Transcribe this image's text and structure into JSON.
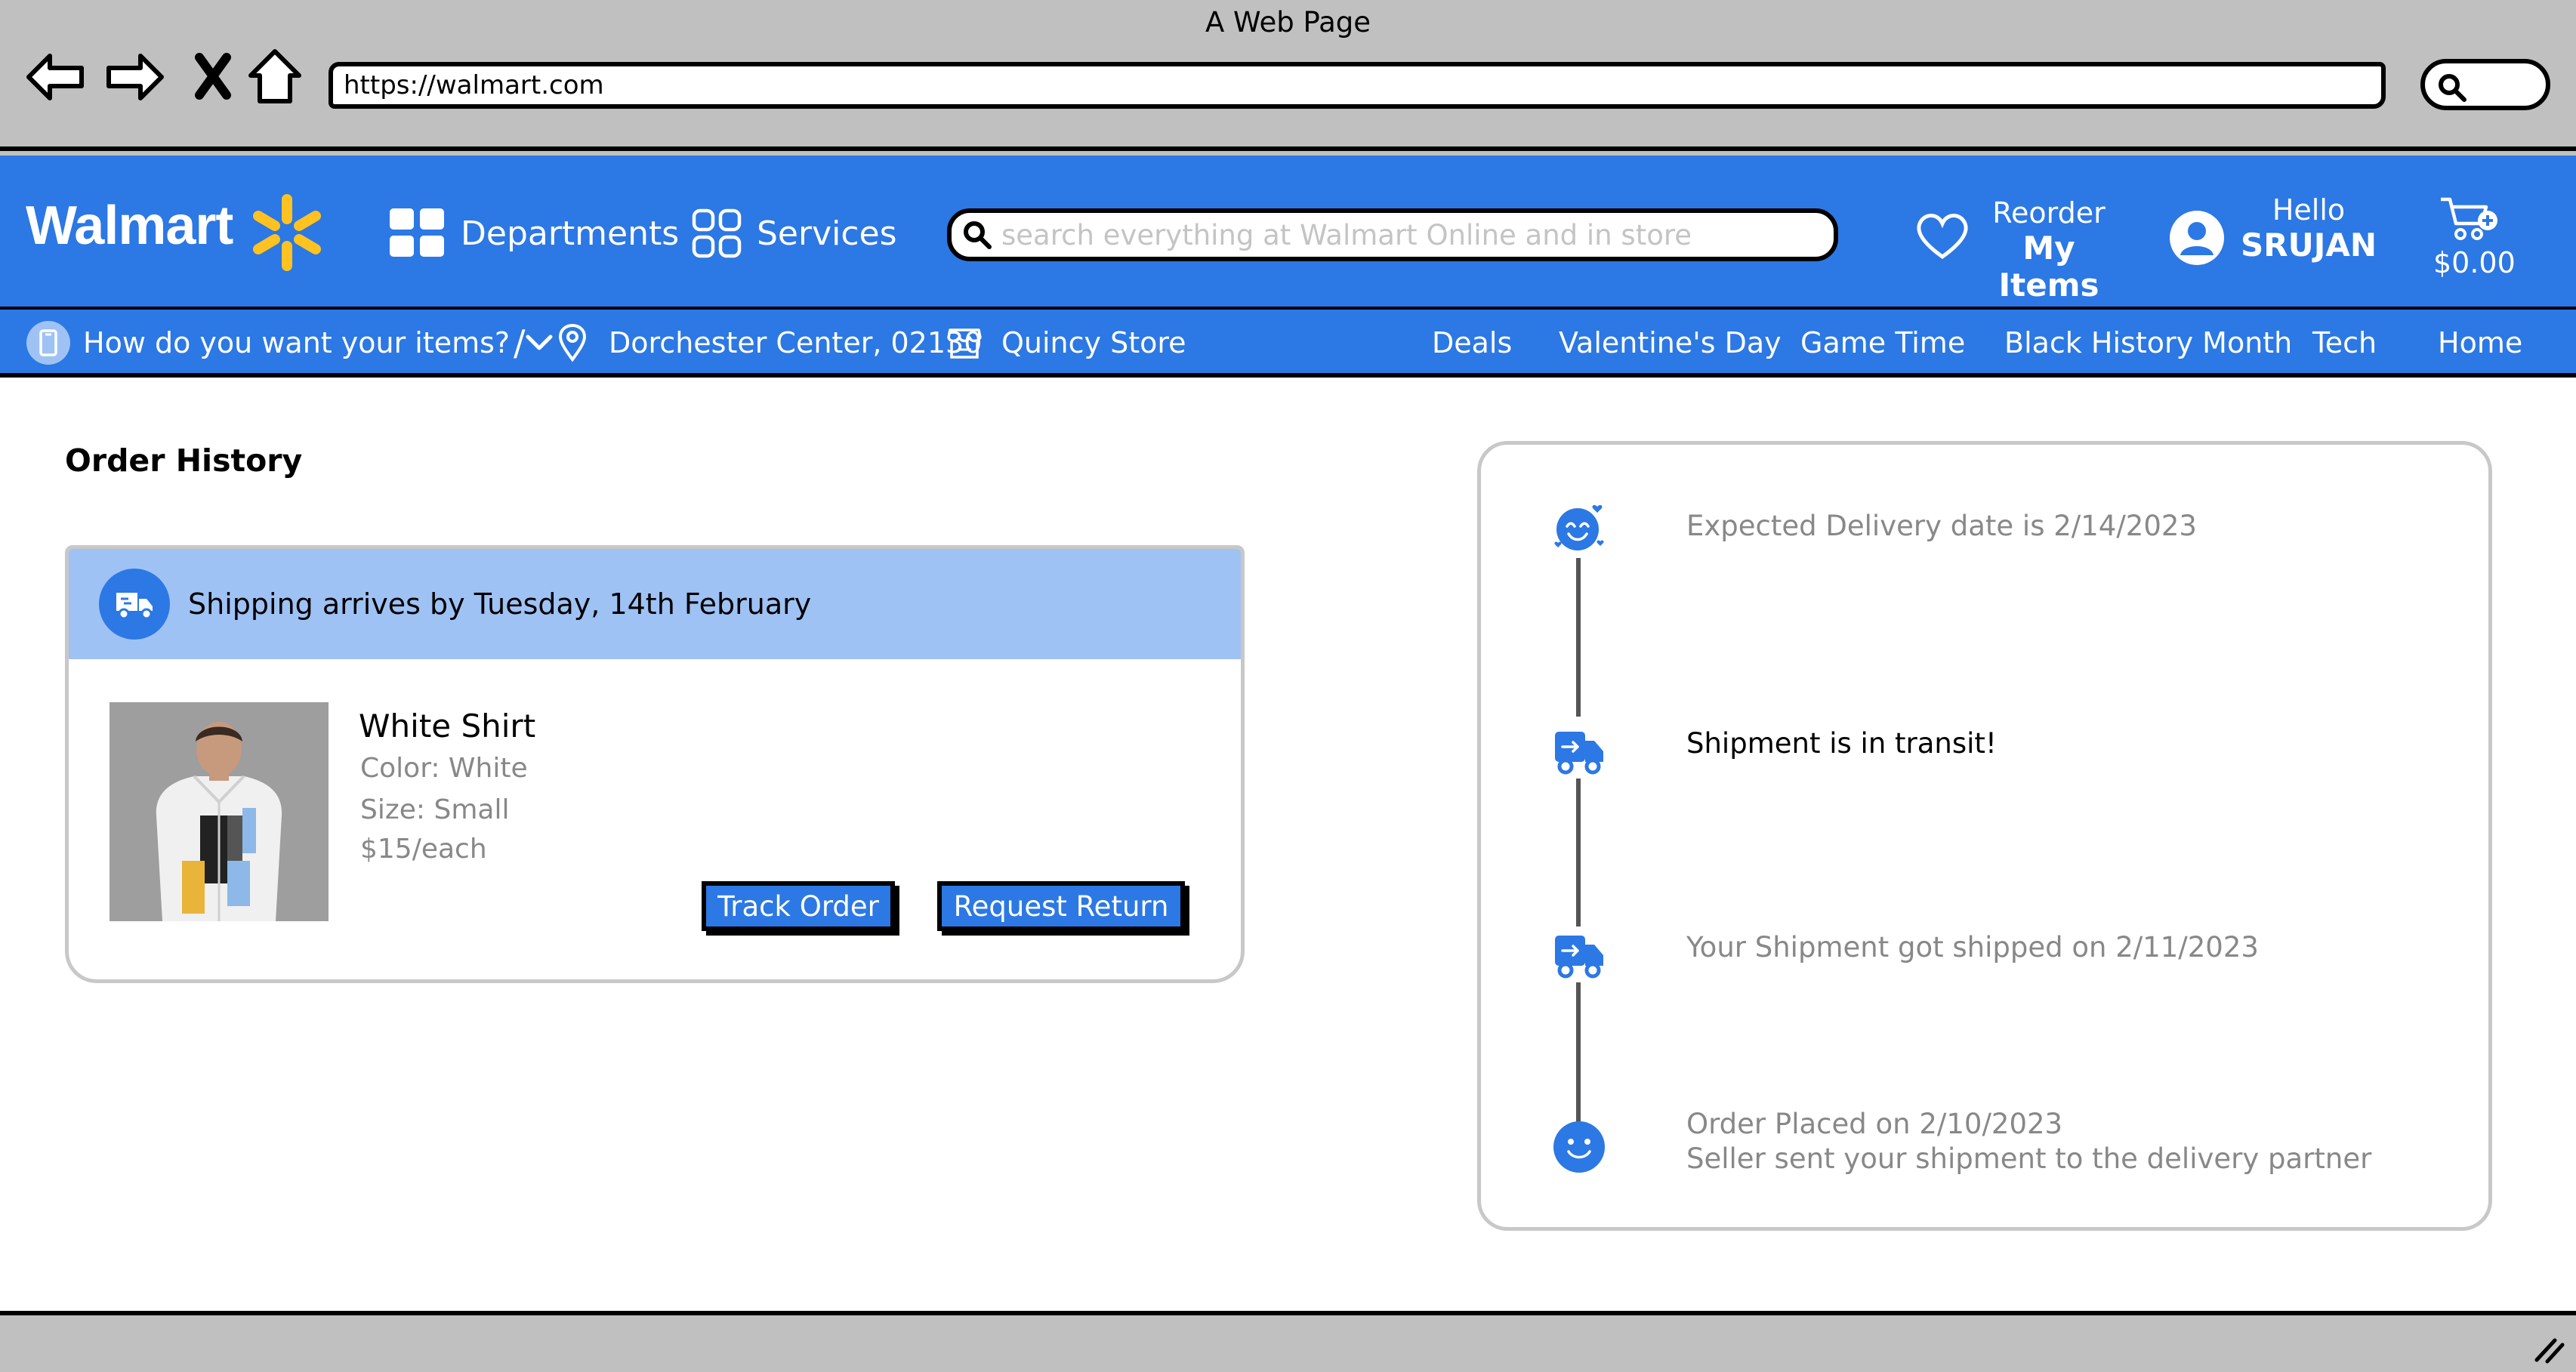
{
  "window": {
    "title": "A Web Page",
    "url": "https://walmart.com"
  },
  "header": {
    "logo_text": "Walmart",
    "departments_label": "Departments",
    "services_label": "Services",
    "search_placeholder": "search everything at Walmart Online and in store",
    "reorder_line1": "Reorder",
    "reorder_line2": "My Items",
    "account_line1": "Hello",
    "account_line2": "SRUJAN",
    "cart_total": "$0.00"
  },
  "subnav": {
    "fulfillment_label": "How do you want your items?",
    "divider": "/",
    "location_label": "Dorchester Center, 02130",
    "store_label": "Quincy Store",
    "promos": [
      "Deals",
      "Valentine's Day",
      "Game Time",
      "Black History Month",
      "Tech",
      "Home"
    ]
  },
  "order_history": {
    "title": "Order History",
    "shipping_banner": "Shipping arrives by Tuesday, 14th February",
    "product": {
      "name": "White Shirt",
      "color": "Color: White",
      "size": "Size: Small",
      "price": "$15/each"
    },
    "track_label": "Track Order",
    "return_label": "Request Return"
  },
  "timeline": [
    {
      "icon": "happy-love-face-icon",
      "line1": "Expected Delivery date is 2/14/2023",
      "line2": "",
      "active": false
    },
    {
      "icon": "delivery-truck-icon",
      "line1": "Shipment is in transit!",
      "line2": "",
      "active": true
    },
    {
      "icon": "delivery-truck-icon",
      "line1": "Your Shipment got shipped on 2/11/2023",
      "line2": "",
      "active": false
    },
    {
      "icon": "smiley-face-icon",
      "line1": "Order Placed on 2/10/2023",
      "line2": "Seller sent your shipment to the delivery partner",
      "active": false
    }
  ],
  "colors": {
    "brand_blue": "#2c78e4",
    "banner_blue": "#9fc2f5",
    "spark_yellow": "#ffc220",
    "muted_text": "#888888"
  }
}
